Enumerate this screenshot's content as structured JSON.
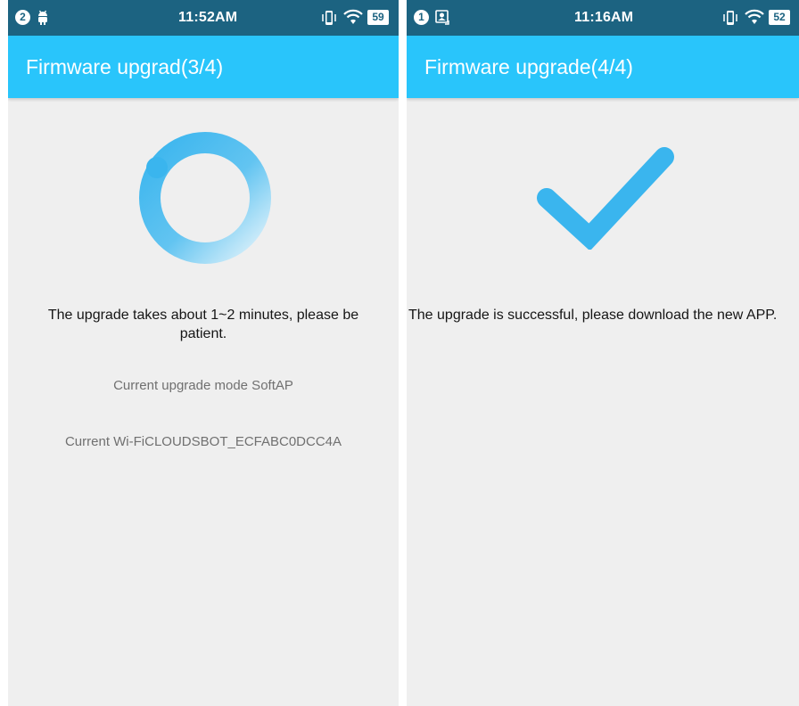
{
  "left_screen": {
    "status_bar": {
      "notification_count": "2",
      "time": "11:52AM",
      "battery_level": "59"
    },
    "title": "Firmware upgrad(3/4)",
    "message": "The upgrade takes about 1~2 minutes, please be patient.",
    "upgrade_mode": "Current upgrade mode SoftAP",
    "current_wifi": "Current Wi-FiCLOUDSBOT_ECFABC0DCC4A",
    "icons": [
      "android-icon",
      "vibrate-icon",
      "wifi-icon",
      "battery-icon",
      "loading-spinner-icon"
    ]
  },
  "right_screen": {
    "status_bar": {
      "notification_count": "1",
      "time": "11:16AM",
      "battery_level": "52"
    },
    "title": "Firmware upgrade(4/4)",
    "message": "The upgrade is successful, please download the new APP.",
    "icons": [
      "screenshot-icon",
      "vibrate-icon",
      "wifi-icon",
      "battery-icon",
      "checkmark-icon"
    ]
  },
  "colors": {
    "status_bar": "#1c6381",
    "app_bar": "#29c5fb",
    "background": "#efefef",
    "accent": "#3ab5ee"
  }
}
